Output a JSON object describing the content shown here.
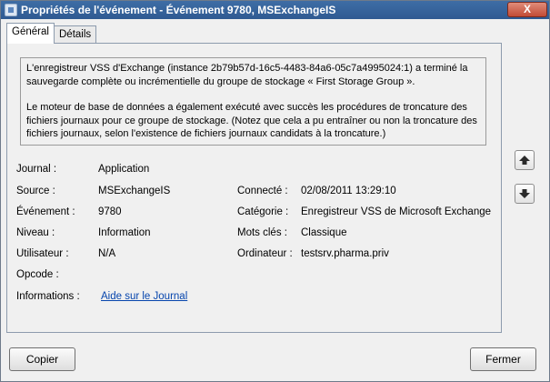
{
  "window": {
    "title": "Propriétés de l'événement - Événement 9780, MSExchangeIS",
    "close_label": "X"
  },
  "tabs": [
    {
      "label": "Général",
      "active": true
    },
    {
      "label": "Détails",
      "active": false
    }
  ],
  "description": {
    "paragraph1": "L'enregistreur VSS d'Exchange (instance 2b79b57d-16c5-4483-84a6-05c7a4995024:1) a terminé la sauvegarde complète ou incrémentielle du groupe de stockage « First Storage Group ».",
    "paragraph2": "Le moteur de base de données a également exécuté avec succès les procédures de troncature des fichiers journaux pour ce groupe de stockage. (Notez que cela a pu entraîner ou non la troncature des fichiers journaux, selon l'existence de fichiers journaux candidats à la troncature.)"
  },
  "fields": {
    "journal": {
      "label": "Journal :",
      "value": "Application"
    },
    "source": {
      "label": "Source :",
      "value": "MSExchangeIS"
    },
    "evenement": {
      "label": "Événement :",
      "value": "9780"
    },
    "niveau": {
      "label": "Niveau :",
      "value": "Information"
    },
    "utilisateur": {
      "label": "Utilisateur :",
      "value": "N/A"
    },
    "opcode": {
      "label": "Opcode :",
      "value": ""
    },
    "informations": {
      "label": "Informations :",
      "value": "Aide sur le Journal"
    },
    "connecte": {
      "label": "Connecté :",
      "value": "02/08/2011 13:29:10"
    },
    "categorie": {
      "label": "Catégorie :",
      "value": "Enregistreur VSS de Microsoft Exchange"
    },
    "mots_cles": {
      "label": "Mots clés :",
      "value": "Classique"
    },
    "ordinateur": {
      "label": "Ordinateur :",
      "value": "testsrv.pharma.priv"
    }
  },
  "buttons": {
    "copy": "Copier",
    "close": "Fermer"
  },
  "icons": {
    "up": "arrow-up-icon",
    "down": "arrow-down-icon"
  }
}
